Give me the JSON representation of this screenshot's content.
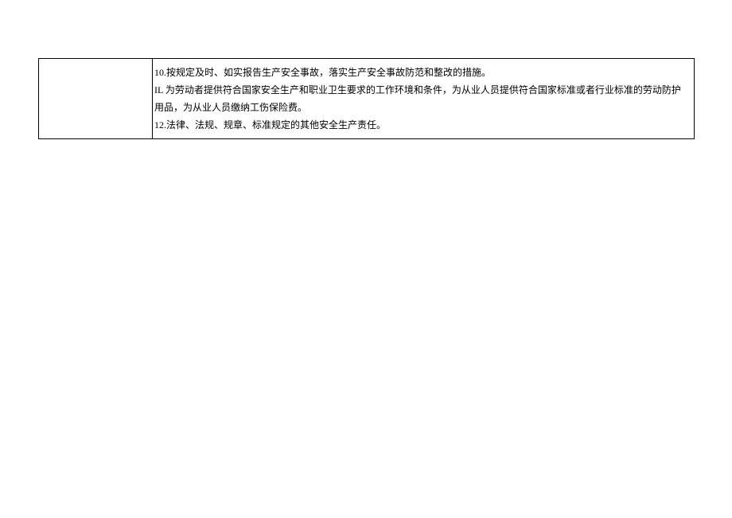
{
  "table": {
    "rows": [
      {
        "left": "",
        "right_lines": [
          "10.按规定及时、如实报告生产安全事故，落实生产安全事故防范和整改的措施。",
          "IL 为劳动者提供符合国家安全生产和职业卫生要求的工作环境和条件，为从业人员提供符合国家标准或者行业标准的劳动防护用品，为从业人员缴纳工伤保险费。",
          "12.法律、法规、规章、标准规定的其他安全生产责任。"
        ]
      }
    ]
  }
}
